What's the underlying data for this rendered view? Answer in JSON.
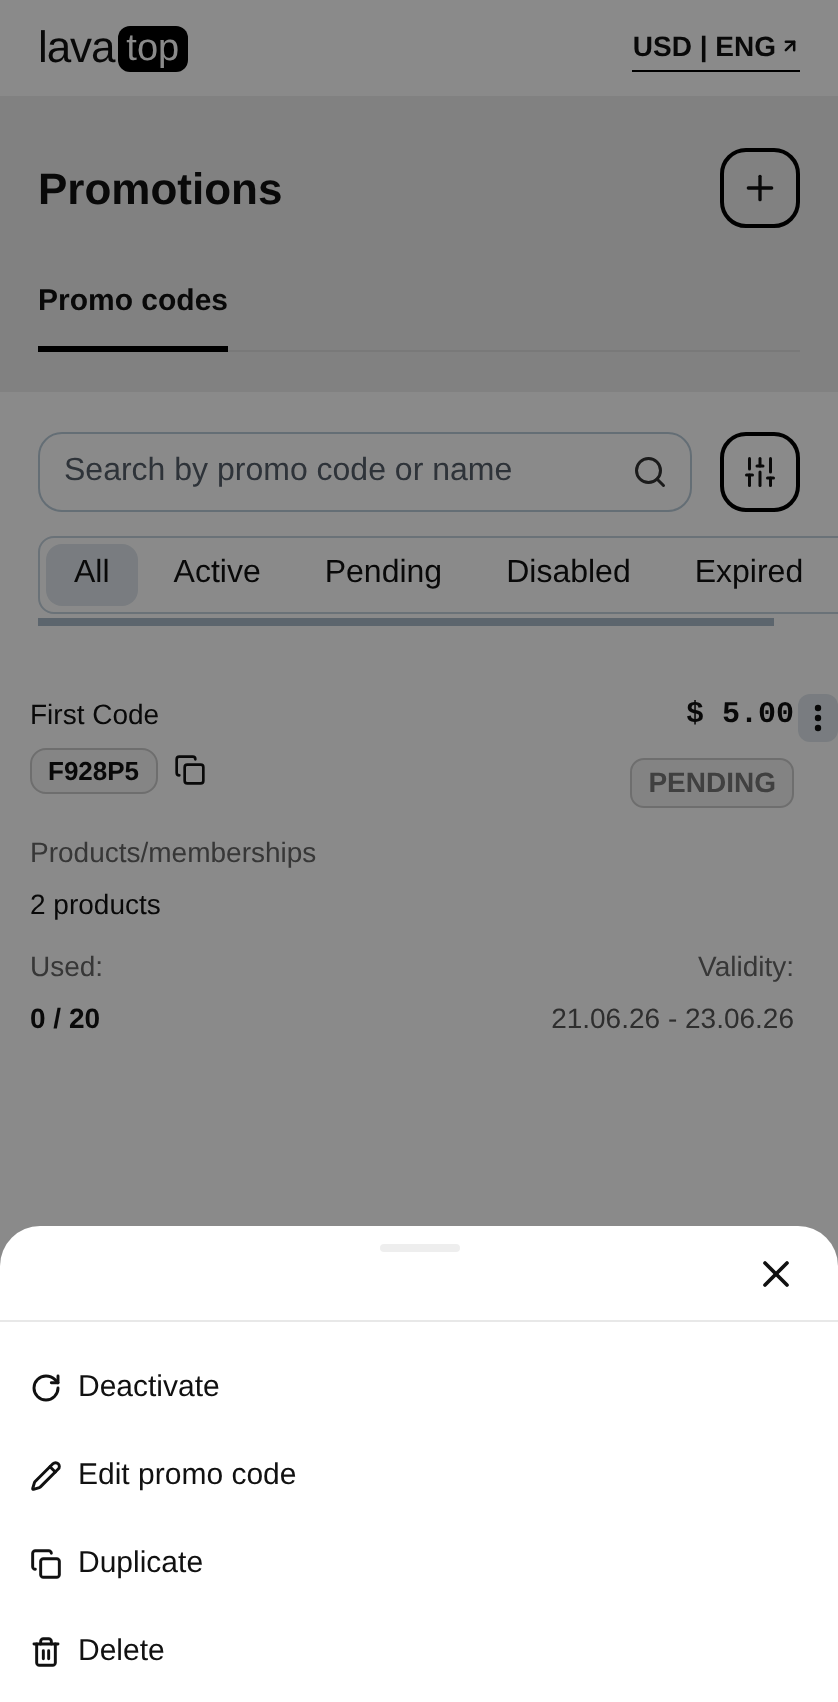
{
  "header": {
    "logo": {
      "word": "lava",
      "badge": "top"
    },
    "locale_link": "USD | ENG"
  },
  "page": {
    "title": "Promotions",
    "tabs": [
      {
        "label": "Promo codes",
        "selected": true
      }
    ]
  },
  "search": {
    "placeholder": "Search by promo code or name"
  },
  "filters": [
    {
      "label": "All",
      "selected": true
    },
    {
      "label": "Active",
      "selected": false
    },
    {
      "label": "Pending",
      "selected": false
    },
    {
      "label": "Disabled",
      "selected": false
    },
    {
      "label": "Expired",
      "selected": false
    }
  ],
  "promo_card": {
    "name": "First Code",
    "code": "F928P5",
    "price": "$ 5.00",
    "status": "PENDING",
    "products_label": "Products/memberships",
    "products_value": "2 products",
    "used_label": "Used:",
    "used_value": "0 / 20",
    "validity_label": "Validity:",
    "validity_value": "21.06.26 - 23.06.26"
  },
  "sheet": {
    "actions": [
      {
        "kind": "deactivate",
        "label": "Deactivate"
      },
      {
        "kind": "edit",
        "label": "Edit promo code"
      },
      {
        "kind": "duplicate",
        "label": "Duplicate"
      },
      {
        "kind": "delete",
        "label": "Delete"
      }
    ]
  }
}
